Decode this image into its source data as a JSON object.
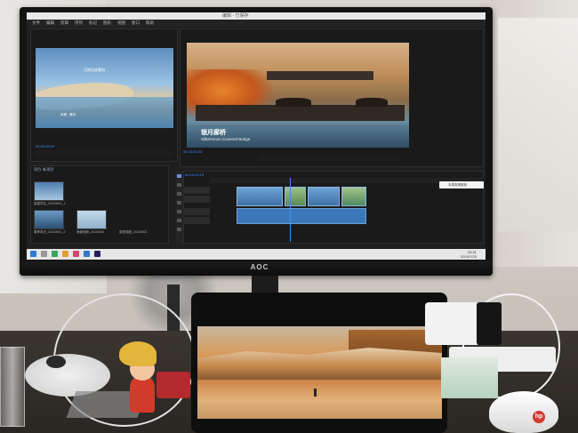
{
  "monitor": {
    "brand": "AOC",
    "window_title": "编辑 - 已保存",
    "menu": [
      "文件",
      "编辑",
      "剪辑",
      "序列",
      "标记",
      "图形",
      "视图",
      "窗口",
      "帮助"
    ],
    "source_caption": "可视动态素材",
    "source_caption2": "来源 · 素材",
    "program_title": "银月廊桥",
    "program_subtitle": "Silbermoon Covered Bridge",
    "source_timecode": "00:00:43:19",
    "program_timecode": "00:15:24:03",
    "timeline_timecode": "00:15:24:15",
    "project_tab": "项目: 新项目",
    "project_items": [
      "新建项目_20240601_1",
      "春季风光_20240601_2",
      "海景视频_20240601",
      "家庭视频_20240601"
    ],
    "notice": "本周剪辑更新",
    "taskbar_time": "20:31",
    "taskbar_date": "2024/7/25"
  },
  "tablet": {
    "scene": "canyon-walker"
  },
  "colors": {
    "accent_blue": "#3d8eff",
    "clip_blue": "#3d6fa4",
    "hp_red": "#d33a2f"
  }
}
